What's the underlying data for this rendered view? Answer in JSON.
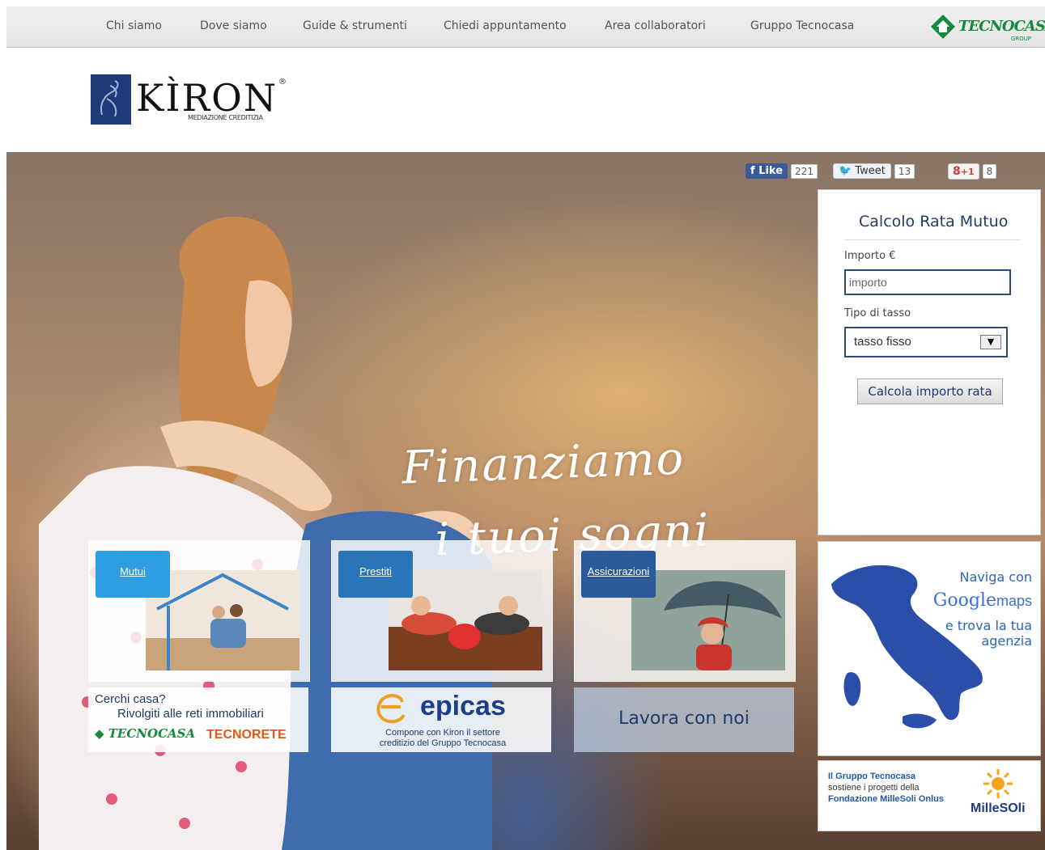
{
  "topnav": {
    "items": [
      "Chi siamo",
      "Dove siamo",
      "Guide & strumenti",
      "Chiedi appuntamento",
      "Area collaboratori",
      "Gruppo Tecnocasa"
    ],
    "group_logo": {
      "text": "TECNOCASA",
      "sub": "GROUP"
    }
  },
  "brand": {
    "name": "KÌRON",
    "subtitle": "MEDIAZIONE CREDITIZIA",
    "reg": "®"
  },
  "hero": {
    "slogan_line1": "Finanziamo",
    "slogan_line2": "i tuoi sogni"
  },
  "social": {
    "like_label": "Like",
    "like_count": "221",
    "tweet_label": "Tweet",
    "tweet_count": "13",
    "gplus_label": "+1",
    "gplus_count": "8"
  },
  "calc": {
    "title": "Calcolo Rata Mutuo",
    "importo_label": "Importo €",
    "importo_placeholder": "importo",
    "tasso_label": "Tipo di tasso",
    "tasso_value": "tasso fisso",
    "button": "Calcola importo rata"
  },
  "tiles": [
    {
      "label": "Mutui",
      "image": "family-house-photo"
    },
    {
      "label": "Prestiti",
      "image": "couple-piggybank-photo"
    },
    {
      "label": "Assicurazioni",
      "image": "woman-umbrella-photo"
    }
  ],
  "promo": {
    "cerchi": "Cerchi casa?",
    "rivolgiti": "Rivolgiti alle reti immobiliari",
    "tecnocasa": "TECNOCASA",
    "tecnorete": "TECNORETE",
    "epicas": "epicas",
    "epicas_desc": "Compone con Kiron il settore creditizio  del Gruppo Tecnocasa",
    "lavora": "Lavora con noi"
  },
  "maps": {
    "line1": "Naviga con",
    "google": "Google",
    "maps": "maps",
    "line3": "e trova la tua",
    "line4": "agenzia"
  },
  "millesoli": {
    "t1": "Il Gruppo Tecnocasa",
    "t2": "sostiene i progetti della",
    "t3": "Fondazione MilleSoli Onlus",
    "logo": "MilleSOli"
  },
  "colors": {
    "accent": "#2f9ee0",
    "brand_navy": "#1f3a6a",
    "tecnocasa_green": "#148a3a"
  }
}
